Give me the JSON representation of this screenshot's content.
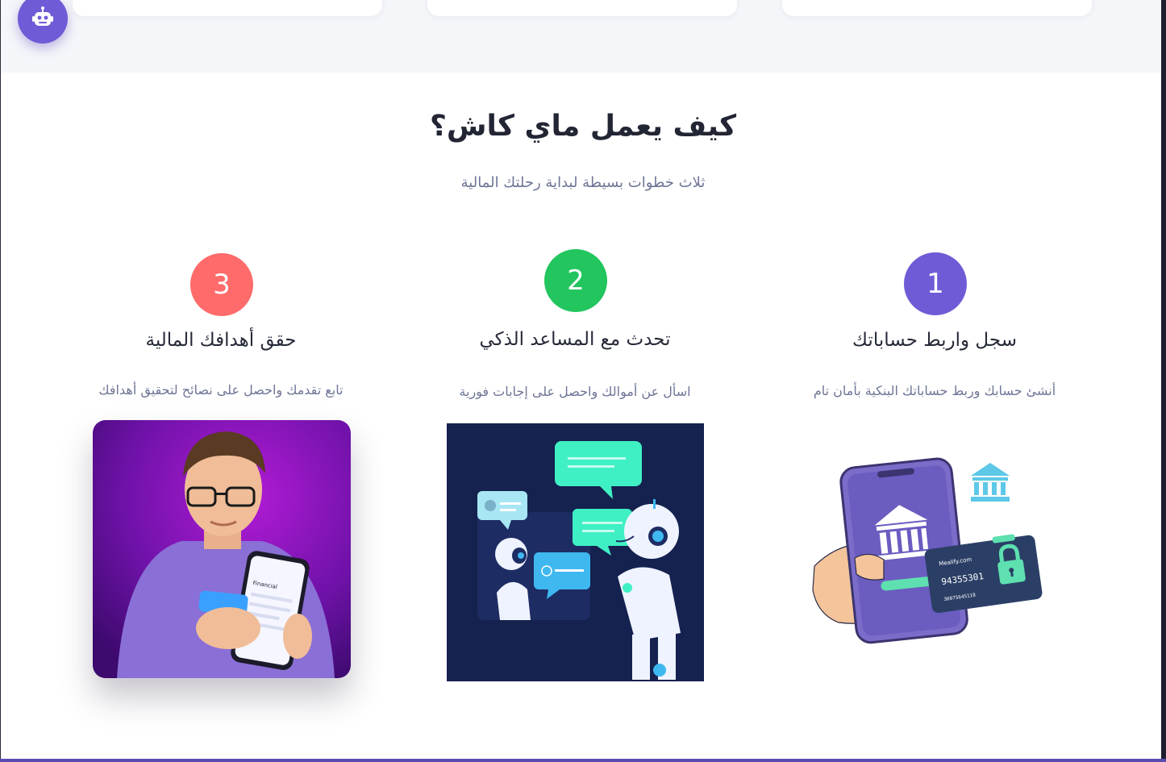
{
  "section": {
    "title": "كيف يعمل ماي كاش؟",
    "subtitle": "ثلاث خطوات بسيطة لبداية رحلتك المالية"
  },
  "steps": [
    {
      "number": "1",
      "title": "سجل واربط حساباتك",
      "description": "أنشئ حسابك وربط حساباتك البنكية بأمان تام",
      "color": "#6f5bd6",
      "card_phone": "94355301",
      "card_number": "3007564S118",
      "card_brand": "Mealify.com"
    },
    {
      "number": "2",
      "title": "تحدث مع المساعد الذكي",
      "description": "اسأل عن أموالك واحصل على إجابات فورية",
      "color": "#22c55e"
    },
    {
      "number": "3",
      "title": "حقق أهدافك المالية",
      "description": "تابع تقدمك واحصل على نصائح لتحقيق أهدافك",
      "color": "#ff6b6b",
      "phone_screen_label": "Financial"
    }
  ],
  "assistant_fab": {
    "icon": "robot-icon"
  }
}
